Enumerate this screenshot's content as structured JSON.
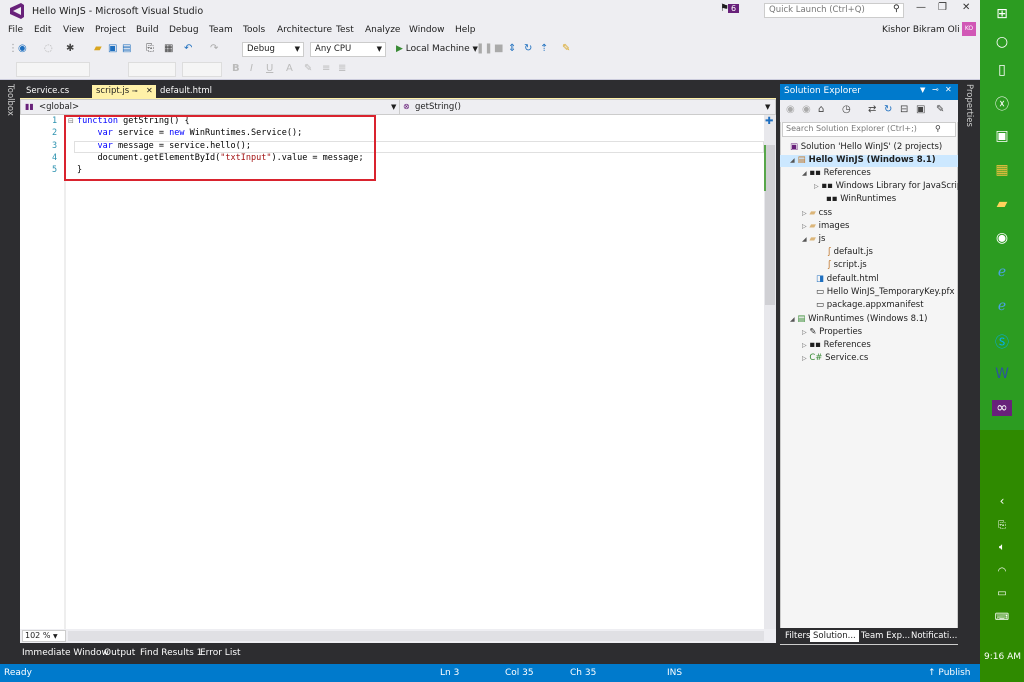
{
  "window": {
    "title": "Hello WinJS - Microsoft Visual Studio",
    "notif_count": "6",
    "quick_launch_placeholder": "Quick Launch (Ctrl+Q)"
  },
  "menu": [
    "File",
    "Edit",
    "View",
    "Project",
    "Build",
    "Debug",
    "Team",
    "Tools",
    "Architecture",
    "Test",
    "Analyze",
    "Window",
    "Help"
  ],
  "user": {
    "name": "Kishor Bikram Oli",
    "initials": "KO"
  },
  "toolbar": {
    "config": "Debug",
    "platform": "Any CPU",
    "run_target": "Local Machine"
  },
  "doc_tabs": [
    {
      "label": "Service.cs"
    },
    {
      "label": "script.js",
      "active": true
    },
    {
      "label": "default.html"
    }
  ],
  "navbar": {
    "left": "<global>",
    "right": "getString()"
  },
  "code": {
    "lines": [
      "1",
      "2",
      "3",
      "4",
      "5"
    ]
  },
  "side_tabs": {
    "left": "Toolbox",
    "right": "Properties"
  },
  "editor": {
    "zoom": "102 %"
  },
  "bottom_tabs": [
    "Immediate Window",
    "Output",
    "Find Results 1",
    "Error List"
  ],
  "status": {
    "state": "Ready",
    "line": "Ln 3",
    "col": "Col 35",
    "ch": "Ch 35",
    "mode": "INS",
    "publish": "Publish"
  },
  "solution_explorer": {
    "title": "Solution Explorer",
    "search_placeholder": "Search Solution Explorer (Ctrl+;)",
    "tree": [
      {
        "label": "Solution 'Hello WinJS' (2 projects)",
        "depth": 0
      },
      {
        "label": "Hello WinJS (Windows 8.1)",
        "depth": 0,
        "selected": true
      },
      {
        "label": "References",
        "depth": 1
      },
      {
        "label": "Windows Library for JavaScript",
        "depth": 2
      },
      {
        "label": "WinRuntimes",
        "depth": 2
      },
      {
        "label": "css",
        "depth": 1
      },
      {
        "label": "images",
        "depth": 1
      },
      {
        "label": "js",
        "depth": 1
      },
      {
        "label": "default.js",
        "depth": 2
      },
      {
        "label": "script.js",
        "depth": 2
      },
      {
        "label": "default.html",
        "depth": 1
      },
      {
        "label": "Hello WinJS_TemporaryKey.pfx",
        "depth": 1
      },
      {
        "label": "package.appxmanifest",
        "depth": 1
      },
      {
        "label": "WinRuntimes (Windows 8.1)",
        "depth": 0
      },
      {
        "label": "Properties",
        "depth": 1
      },
      {
        "label": "References",
        "depth": 1
      },
      {
        "label": "Service.cs",
        "depth": 1
      }
    ],
    "tabs": [
      {
        "label": "Filters"
      },
      {
        "label": "Solution...",
        "active": true
      },
      {
        "label": "Team Exp..."
      },
      {
        "label": "Notificati..."
      }
    ]
  },
  "system": {
    "time": "9:16 AM"
  }
}
